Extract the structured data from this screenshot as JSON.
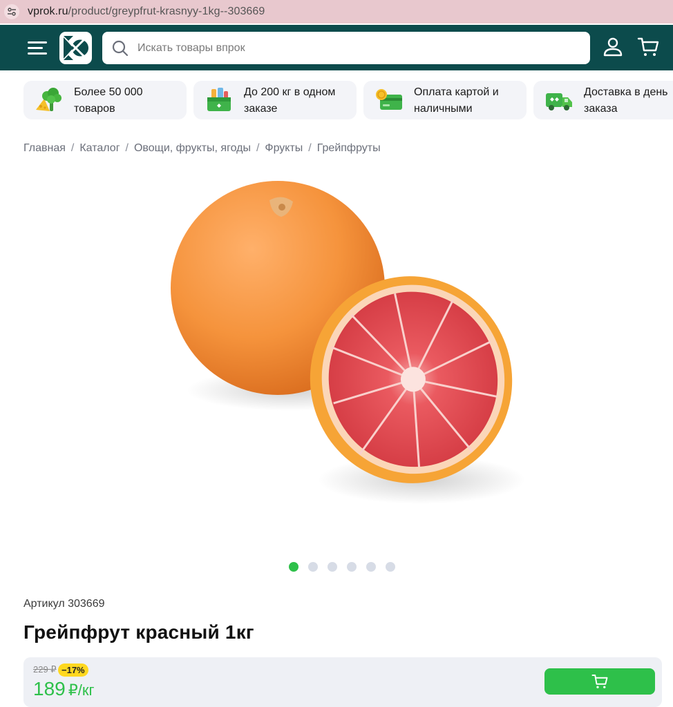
{
  "browser": {
    "url_domain": "vprok.ru",
    "url_path": "/product/greypfrut-krasnyy-1kg--303669"
  },
  "header": {
    "search_placeholder": "Искать товары впрок"
  },
  "advantages": [
    {
      "icon": "broccoli-cheese-icon",
      "text": "Более 50 000 товаров"
    },
    {
      "icon": "grocery-box-icon",
      "text": "До 200 кг в одном заказе"
    },
    {
      "icon": "card-coin-icon",
      "text": "Оплата картой и наличными"
    },
    {
      "icon": "delivery-truck-icon",
      "text": "Доставка в день заказа"
    }
  ],
  "breadcrumb": [
    "Главная",
    "Каталог",
    "Овощи, фрукты, ягоды",
    "Фрукты",
    "Грейпфруты"
  ],
  "gallery": {
    "total": 6,
    "active": 1
  },
  "product": {
    "sku_label": "Артикул 303669",
    "title": "Грейпфрут красный 1кг",
    "old_price": "229 ₽",
    "discount": "−17%",
    "price": "189",
    "price_unit": "₽/кг"
  },
  "colors": {
    "header_bg": "#0c4b4c",
    "accent_green": "#2ec04a",
    "discount_yellow": "#ffd81f"
  }
}
